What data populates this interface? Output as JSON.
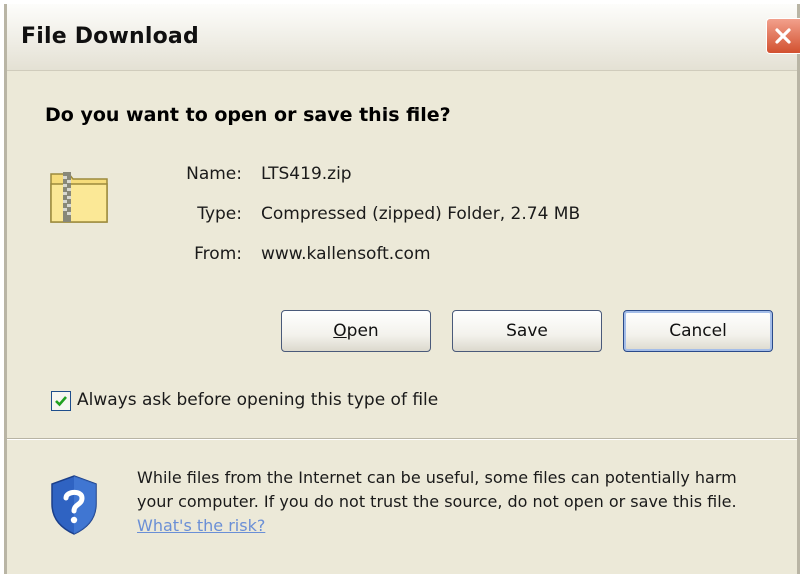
{
  "window": {
    "title": "File Download"
  },
  "prompt": {
    "question": "Do you want to open or save this file?"
  },
  "file": {
    "name_label": "Name:",
    "name": "LTS419.zip",
    "type_label": "Type:",
    "type": "Compressed (zipped) Folder, 2.74 MB",
    "from_label": "From:",
    "from": "www.kallensoft.com",
    "icon": "zip-folder-icon"
  },
  "buttons": {
    "open_first": "O",
    "open_rest": "pen",
    "save": "Save",
    "cancel": "Cancel"
  },
  "checkbox": {
    "checked": true,
    "label": "Always ask before opening this type of file"
  },
  "warning": {
    "text": "While files from the Internet can be useful, some files can potentially harm your computer. If you do not trust the source, do not open or save this file.",
    "link": "What's the risk?",
    "icon": "security-shield-icon"
  },
  "colors": {
    "link": "#6a8fd6",
    "dialog_bg": "#ece9d8",
    "close_red": "#d2512f"
  }
}
